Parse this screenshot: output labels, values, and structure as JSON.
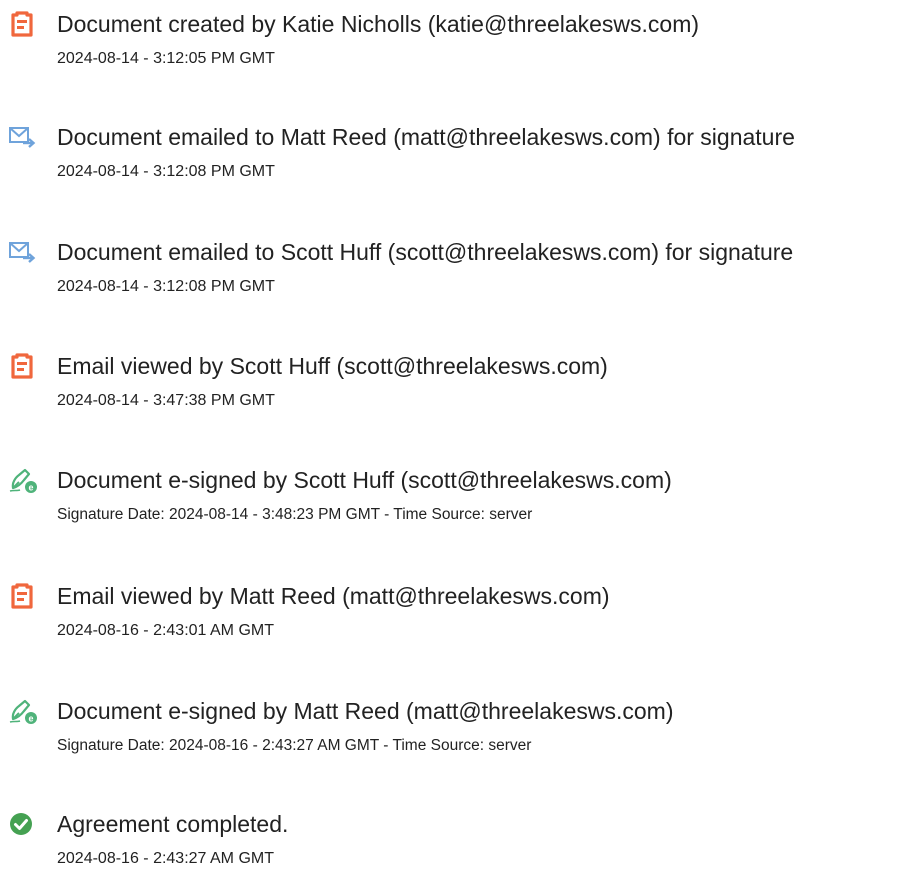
{
  "colors": {
    "created_icon": "#f0673d",
    "email_icon": "#6fa3db",
    "sign_icon": "#4fb37a",
    "complete_icon": "#45a152"
  },
  "events": [
    {
      "icon": "document-orange-icon",
      "title": "Document created by Katie Nicholls (katie@threelakesws.com)",
      "detail": "2024-08-14 - 3:12:05 PM GMT"
    },
    {
      "icon": "email-send-icon",
      "title": "Document emailed to Matt Reed (matt@threelakesws.com) for signature",
      "detail": "2024-08-14 - 3:12:08 PM GMT"
    },
    {
      "icon": "email-send-icon",
      "title": "Document emailed to Scott Huff (scott@threelakesws.com) for signature",
      "detail": "2024-08-14 - 3:12:08 PM GMT"
    },
    {
      "icon": "document-orange-icon",
      "title": "Email viewed by Scott Huff (scott@threelakesws.com)",
      "detail": "2024-08-14 - 3:47:38 PM GMT"
    },
    {
      "icon": "e-sign-pen-icon",
      "title": "Document e-signed by Scott Huff (scott@threelakesws.com)",
      "detail": "Signature Date: 2024-08-14 - 3:48:23 PM GMT - Time Source: server"
    },
    {
      "icon": "document-orange-icon",
      "title": "Email viewed by Matt Reed (matt@threelakesws.com)",
      "detail": "2024-08-16 - 2:43:01 AM GMT"
    },
    {
      "icon": "e-sign-pen-icon",
      "title": "Document e-signed by Matt Reed (matt@threelakesws.com)",
      "detail": "Signature Date: 2024-08-16 - 2:43:27 AM GMT - Time Source: server"
    },
    {
      "icon": "checkmark-circle-icon",
      "title": "Agreement completed.",
      "detail": "2024-08-16 - 2:43:27 AM GMT"
    }
  ]
}
